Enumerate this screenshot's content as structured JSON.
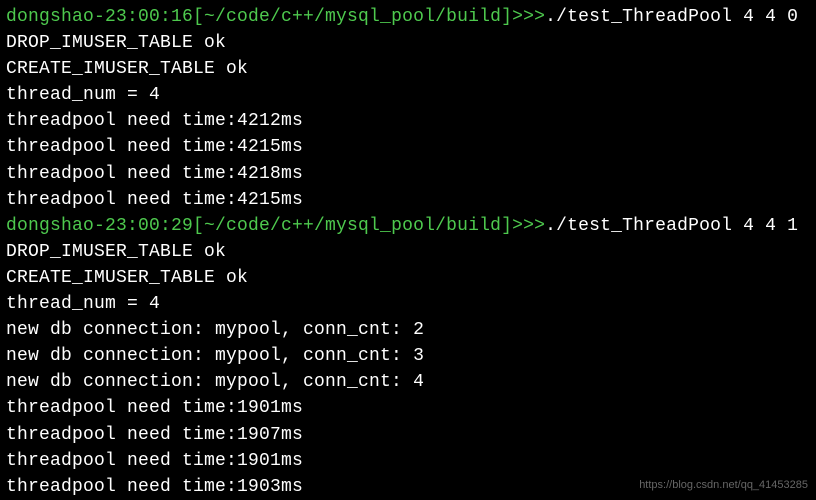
{
  "lines": [
    {
      "type": "prompt",
      "user_time": "dongshao-23:00:16",
      "path": "[~/code/c++/mysql_pool/build]",
      "arrows": ">>>",
      "command": "./test_ThreadPool 4 4 0"
    },
    {
      "type": "output",
      "text": "DROP_IMUSER_TABLE ok"
    },
    {
      "type": "output",
      "text": "CREATE_IMUSER_TABLE ok"
    },
    {
      "type": "output",
      "text": "thread_num = 4"
    },
    {
      "type": "output",
      "text": "threadpool need time:4212ms"
    },
    {
      "type": "output",
      "text": "threadpool need time:4215ms"
    },
    {
      "type": "output",
      "text": "threadpool need time:4218ms"
    },
    {
      "type": "output",
      "text": "threadpool need time:4215ms"
    },
    {
      "type": "prompt",
      "user_time": "dongshao-23:00:29",
      "path": "[~/code/c++/mysql_pool/build]",
      "arrows": ">>>",
      "command": "./test_ThreadPool 4 4 1"
    },
    {
      "type": "output",
      "text": "DROP_IMUSER_TABLE ok"
    },
    {
      "type": "output",
      "text": "CREATE_IMUSER_TABLE ok"
    },
    {
      "type": "output",
      "text": "thread_num = 4"
    },
    {
      "type": "output",
      "text": "new db connection: mypool, conn_cnt: 2"
    },
    {
      "type": "output",
      "text": "new db connection: mypool, conn_cnt: 3"
    },
    {
      "type": "output",
      "text": "new db connection: mypool, conn_cnt: 4"
    },
    {
      "type": "output",
      "text": "threadpool need time:1901ms"
    },
    {
      "type": "output",
      "text": "threadpool need time:1907ms"
    },
    {
      "type": "output",
      "text": "threadpool need time:1901ms"
    },
    {
      "type": "output",
      "text": "threadpool need time:1903ms"
    }
  ],
  "watermark": "https://blog.csdn.net/qq_41453285"
}
